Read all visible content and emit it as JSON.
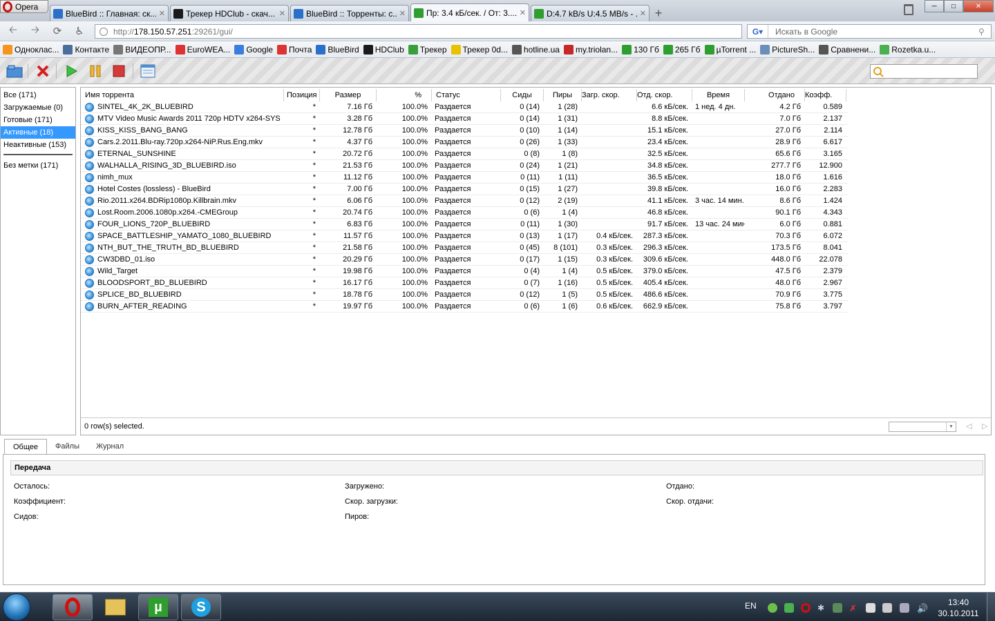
{
  "browser": {
    "menu_label": "Opera",
    "tabs": [
      {
        "label": "BlueBird :: Главная: ск...",
        "active": false,
        "color": "#2a6fc9"
      },
      {
        "label": "Трекер HDClub - скач...",
        "active": false,
        "color": "#1b1b1b"
      },
      {
        "label": "BlueBird :: Торренты: с...",
        "active": false,
        "color": "#2a6fc9"
      },
      {
        "label": "Пр: 3.4 кБ/сек. / От: 3....",
        "active": true,
        "color": "#2e9e2e"
      },
      {
        "label": "D:4.7 kB/s U:4.5 MB/s - ...",
        "active": false,
        "color": "#2e9e2e"
      }
    ],
    "address": {
      "scheme": "http://",
      "host": "178.150.57.251",
      "rest": ":29261/gui/"
    },
    "search_placeholder": "Искать в Google",
    "bookmarks": [
      {
        "label": "Однoклас...",
        "color": "#f7941d"
      },
      {
        "label": "Контакте",
        "color": "#4a6f9c"
      },
      {
        "label": "ВИДЕОПР...",
        "color": "#777777"
      },
      {
        "label": "EuroWEA...",
        "color": "#d33"
      },
      {
        "label": "Google",
        "color": "#3b7ddd"
      },
      {
        "label": "Почта",
        "color": "#d33"
      },
      {
        "label": "BlueBird",
        "color": "#2a6fc9"
      },
      {
        "label": "HDClub",
        "color": "#1b1b1b"
      },
      {
        "label": "Трекер",
        "color": "#3a9f3a"
      },
      {
        "label": "Трекер 0d...",
        "color": "#e8c200"
      },
      {
        "label": "hotline.ua",
        "color": "#555555"
      },
      {
        "label": "my.triolan...",
        "color": "#c62828"
      },
      {
        "label": "130 Гб",
        "color": "#2e9e2e"
      },
      {
        "label": "265 Гб",
        "color": "#2e9e2e"
      },
      {
        "label": "µTorrent ...",
        "color": "#2e9e2e"
      },
      {
        "label": "PictureSh...",
        "color": "#6a8fb9"
      },
      {
        "label": "Сравнени...",
        "color": "#555555"
      },
      {
        "label": "Rozetka.u...",
        "color": "#4caf50"
      }
    ]
  },
  "sidebar": {
    "items": [
      {
        "label": "Все (171)",
        "selected": false
      },
      {
        "label": "Загружаемые (0)",
        "selected": false
      },
      {
        "label": "Готовые (171)",
        "selected": false
      },
      {
        "label": "Активные (18)",
        "selected": true
      },
      {
        "label": "Неактивные (153)",
        "selected": false
      }
    ],
    "labels": [
      {
        "label": "Без метки (171)"
      }
    ]
  },
  "grid": {
    "columns": [
      "Имя торрента",
      "Позиция",
      "Размер",
      "%",
      "Статус",
      "Сиды",
      "Пиры",
      "Загр. скор.",
      "Отд. скор.",
      "Время",
      "Отдано",
      "Коэфф."
    ],
    "rows": [
      {
        "name": "SINTEL_4K_2K_BLUEBIRD",
        "pos": "*",
        "size": "7.16 Гб",
        "pct": "100.0%",
        "status": "Раздается",
        "seeds": "0 (14)",
        "peers": "1 (28)",
        "down": "",
        "up": "6.6 кБ/сек.",
        "eta": "1 нед. 4 дн.",
        "uploaded": "4.2 Гб",
        "ratio": "0.589"
      },
      {
        "name": "MTV Video Music Awards 2011 720p HDTV x264-SYS",
        "pos": "*",
        "size": "3.28 Гб",
        "pct": "100.0%",
        "status": "Раздается",
        "seeds": "0 (14)",
        "peers": "1 (31)",
        "down": "",
        "up": "8.8 кБ/сек.",
        "eta": "",
        "uploaded": "7.0 Гб",
        "ratio": "2.137"
      },
      {
        "name": "KISS_KISS_BANG_BANG",
        "pos": "*",
        "size": "12.78 Гб",
        "pct": "100.0%",
        "status": "Раздается",
        "seeds": "0 (10)",
        "peers": "1 (14)",
        "down": "",
        "up": "15.1 кБ/сек.",
        "eta": "",
        "uploaded": "27.0 Гб",
        "ratio": "2.114"
      },
      {
        "name": "Cars.2.2011.Blu-ray.720p.x264-NiP.Rus.Eng.mkv",
        "pos": "*",
        "size": "4.37 Гб",
        "pct": "100.0%",
        "status": "Раздается",
        "seeds": "0 (26)",
        "peers": "1 (33)",
        "down": "",
        "up": "23.4 кБ/сек.",
        "eta": "",
        "uploaded": "28.9 Гб",
        "ratio": "6.617"
      },
      {
        "name": "ETERNAL_SUNSHINE",
        "pos": "*",
        "size": "20.72 Гб",
        "pct": "100.0%",
        "status": "Раздается",
        "seeds": "0 (8)",
        "peers": "1 (8)",
        "down": "",
        "up": "32.5 кБ/сек.",
        "eta": "",
        "uploaded": "65.6 Гб",
        "ratio": "3.165"
      },
      {
        "name": "WALHALLA_RISING_3D_BLUEBIRD.iso",
        "pos": "*",
        "size": "21.53 Гб",
        "pct": "100.0%",
        "status": "Раздается",
        "seeds": "0 (24)",
        "peers": "1 (21)",
        "down": "",
        "up": "34.8 кБ/сек.",
        "eta": "",
        "uploaded": "277.7 Гб",
        "ratio": "12.900"
      },
      {
        "name": "nimh_mux",
        "pos": "*",
        "size": "11.12 Гб",
        "pct": "100.0%",
        "status": "Раздается",
        "seeds": "0 (11)",
        "peers": "1 (11)",
        "down": "",
        "up": "36.5 кБ/сек.",
        "eta": "",
        "uploaded": "18.0 Гб",
        "ratio": "1.616"
      },
      {
        "name": "Hotel Costes (lossless) - BlueBird",
        "pos": "*",
        "size": "7.00 Гб",
        "pct": "100.0%",
        "status": "Раздается",
        "seeds": "0 (15)",
        "peers": "1 (27)",
        "down": "",
        "up": "39.8 кБ/сек.",
        "eta": "",
        "uploaded": "16.0 Гб",
        "ratio": "2.283"
      },
      {
        "name": "Rio.2011.x264.BDRip1080p.Killbrain.mkv",
        "pos": "*",
        "size": "6.06 Гб",
        "pct": "100.0%",
        "status": "Раздается",
        "seeds": "0 (12)",
        "peers": "2 (19)",
        "down": "",
        "up": "41.1 кБ/сек.",
        "eta": "3 час. 14 мин.",
        "uploaded": "8.6 Гб",
        "ratio": "1.424"
      },
      {
        "name": "Lost.Room.2006.1080p.x264.-CMEGroup",
        "pos": "*",
        "size": "20.74 Гб",
        "pct": "100.0%",
        "status": "Раздается",
        "seeds": "0 (6)",
        "peers": "1 (4)",
        "down": "",
        "up": "46.8 кБ/сек.",
        "eta": "",
        "uploaded": "90.1 Гб",
        "ratio": "4.343"
      },
      {
        "name": "FOUR_LIONS_720P_BLUEBIRD",
        "pos": "*",
        "size": "6.83 Гб",
        "pct": "100.0%",
        "status": "Раздается",
        "seeds": "0 (11)",
        "peers": "1 (30)",
        "down": "",
        "up": "91.7 кБ/сек.",
        "eta": "13 час. 24 мин",
        "uploaded": "6.0 Гб",
        "ratio": "0.881"
      },
      {
        "name": "SPACE_BATTLESHIP_YAMATO_1080_BLUEBIRD",
        "pos": "*",
        "size": "11.57 Гб",
        "pct": "100.0%",
        "status": "Раздается",
        "seeds": "0 (13)",
        "peers": "1 (17)",
        "down": "0.4 кБ/сек.",
        "up": "287.3 кБ/сек.",
        "eta": "",
        "uploaded": "70.3 Гб",
        "ratio": "6.072"
      },
      {
        "name": "NTH_BUT_THE_TRUTH_BD_BLUEBIRD",
        "pos": "*",
        "size": "21.58 Гб",
        "pct": "100.0%",
        "status": "Раздается",
        "seeds": "0 (45)",
        "peers": "8 (101)",
        "down": "0.3 кБ/сек.",
        "up": "296.3 кБ/сек.",
        "eta": "",
        "uploaded": "173.5 Гб",
        "ratio": "8.041"
      },
      {
        "name": "CW3DBD_01.iso",
        "pos": "*",
        "size": "20.29 Гб",
        "pct": "100.0%",
        "status": "Раздается",
        "seeds": "0 (17)",
        "peers": "1 (15)",
        "down": "0.3 кБ/сек.",
        "up": "309.6 кБ/сек.",
        "eta": "",
        "uploaded": "448.0 Гб",
        "ratio": "22.078"
      },
      {
        "name": "Wild_Target",
        "pos": "*",
        "size": "19.98 Гб",
        "pct": "100.0%",
        "status": "Раздается",
        "seeds": "0 (4)",
        "peers": "1 (4)",
        "down": "0.5 кБ/сек.",
        "up": "379.0 кБ/сек.",
        "eta": "",
        "uploaded": "47.5 Гб",
        "ratio": "2.379"
      },
      {
        "name": "BLOODSPORT_BD_BLUEBIRD",
        "pos": "*",
        "size": "16.17 Гб",
        "pct": "100.0%",
        "status": "Раздается",
        "seeds": "0 (7)",
        "peers": "1 (16)",
        "down": "0.5 кБ/сек.",
        "up": "405.4 кБ/сек.",
        "eta": "",
        "uploaded": "48.0 Гб",
        "ratio": "2.967"
      },
      {
        "name": "SPLICE_BD_BLUEBIRD",
        "pos": "*",
        "size": "18.78 Гб",
        "pct": "100.0%",
        "status": "Раздается",
        "seeds": "0 (12)",
        "peers": "1 (5)",
        "down": "0.5 кБ/сек.",
        "up": "486.6 кБ/сек.",
        "eta": "",
        "uploaded": "70.9 Гб",
        "ratio": "3.775"
      },
      {
        "name": "BURN_AFTER_READING",
        "pos": "*",
        "size": "19.97 Гб",
        "pct": "100.0%",
        "status": "Раздается",
        "seeds": "0 (6)",
        "peers": "1 (6)",
        "down": "0.6 кБ/сек.",
        "up": "662.9 кБ/сек.",
        "eta": "",
        "uploaded": "75.8 Гб",
        "ratio": "3.797"
      }
    ],
    "selection_status": "0 row(s) selected."
  },
  "details": {
    "tabs": [
      "Общее",
      "Файлы",
      "Журнал"
    ],
    "section_title": "Передача",
    "fields": {
      "remaining": "Осталось:",
      "downloaded": "Загружено:",
      "uploaded": "Отдано:",
      "ratio": "Коэффициент:",
      "down_speed": "Скор. загрузки:",
      "up_speed": "Скор. отдачи:",
      "seeds": "Сидов:",
      "peers": "Пиров:"
    }
  },
  "taskbar": {
    "language": "EN",
    "time": "13:40",
    "date": "30.10.2011"
  },
  "colors": {
    "selection": "#3399ff",
    "utorrent_green": "#2e9e2e",
    "opera_red": "#c8100e"
  }
}
